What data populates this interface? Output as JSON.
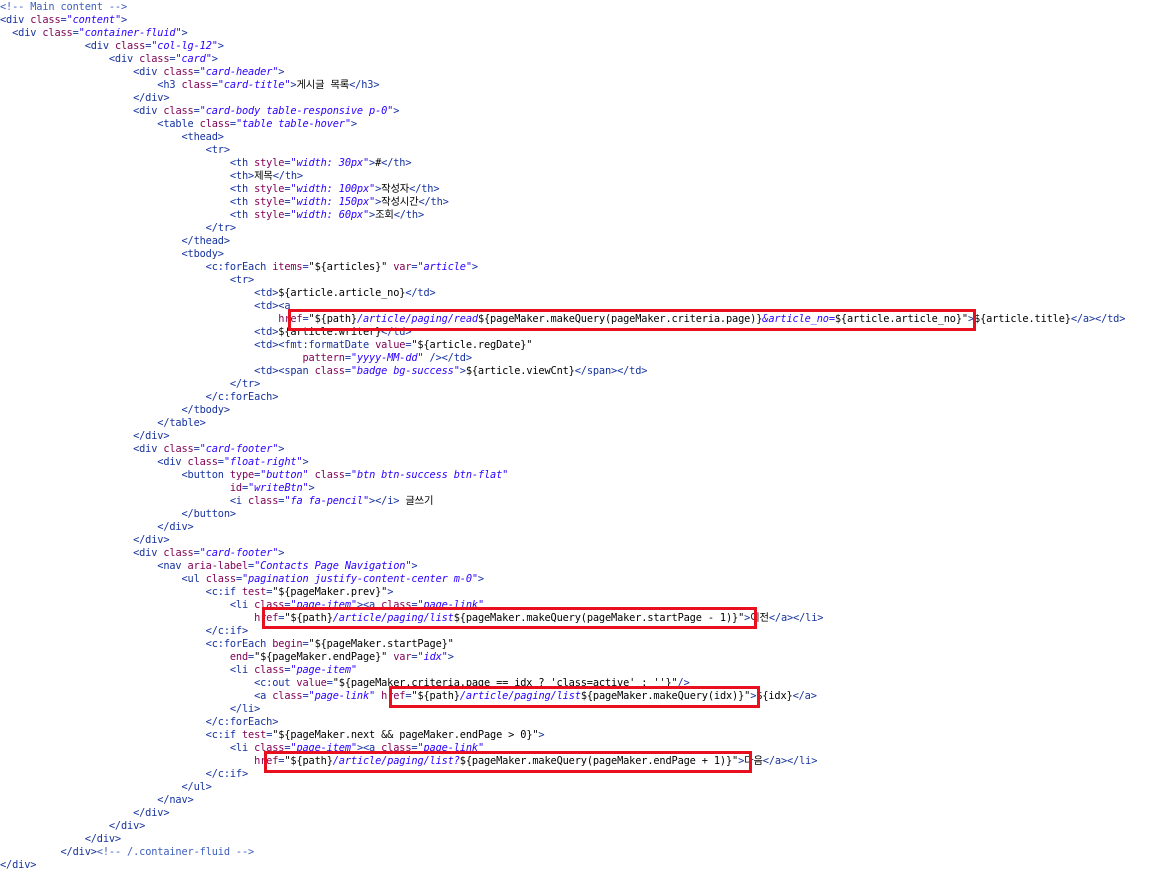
{
  "code_lines": [
    [
      [
        "c",
        "<!-- Main content -->"
      ]
    ],
    [
      [
        "t",
        "<div "
      ],
      [
        "a",
        "class"
      ],
      [
        "t",
        "="
      ],
      [
        "v",
        "\"content\""
      ],
      [
        "t",
        ">"
      ]
    ],
    [
      [
        "t",
        "  <div "
      ],
      [
        "a",
        "class"
      ],
      [
        "t",
        "="
      ],
      [
        "v",
        "\"container-fluid\""
      ],
      [
        "t",
        ">"
      ]
    ],
    [
      [
        "t",
        "              <div "
      ],
      [
        "a",
        "class"
      ],
      [
        "t",
        "="
      ],
      [
        "v",
        "\"col-lg-12\""
      ],
      [
        "t",
        ">"
      ]
    ],
    [
      [
        "t",
        "                  <div "
      ],
      [
        "a",
        "class"
      ],
      [
        "t",
        "="
      ],
      [
        "v",
        "\"card\""
      ],
      [
        "t",
        ">"
      ]
    ],
    [
      [
        "t",
        "                      <div "
      ],
      [
        "a",
        "class"
      ],
      [
        "t",
        "="
      ],
      [
        "v",
        "\"card-header\""
      ],
      [
        "t",
        ">"
      ]
    ],
    [
      [
        "t",
        "                          <h3 "
      ],
      [
        "a",
        "class"
      ],
      [
        "t",
        "="
      ],
      [
        "v",
        "\"card-title\""
      ],
      [
        "t",
        ">"
      ],
      [
        "x",
        "게시글 목록"
      ],
      [
        "t",
        "</h3>"
      ]
    ],
    [
      [
        "t",
        "                      </div>"
      ]
    ],
    [
      [
        "t",
        "                      <div "
      ],
      [
        "a",
        "class"
      ],
      [
        "t",
        "="
      ],
      [
        "v",
        "\"card-body table-responsive p-0\""
      ],
      [
        "t",
        ">"
      ]
    ],
    [
      [
        "t",
        "                          <table "
      ],
      [
        "a",
        "class"
      ],
      [
        "t",
        "="
      ],
      [
        "v",
        "\"table table-hover\""
      ],
      [
        "t",
        ">"
      ]
    ],
    [
      [
        "t",
        "                              <thead>"
      ]
    ],
    [
      [
        "t",
        "                                  <tr>"
      ]
    ],
    [
      [
        "t",
        "                                      <th "
      ],
      [
        "a",
        "style"
      ],
      [
        "t",
        "="
      ],
      [
        "v",
        "\"width: 30px\""
      ],
      [
        "t",
        ">"
      ],
      [
        "x",
        "#"
      ],
      [
        "t",
        "</th>"
      ]
    ],
    [
      [
        "t",
        "                                      <th>"
      ],
      [
        "x",
        "제목"
      ],
      [
        "t",
        "</th>"
      ]
    ],
    [
      [
        "t",
        "                                      <th "
      ],
      [
        "a",
        "style"
      ],
      [
        "t",
        "="
      ],
      [
        "v",
        "\"width: 100px\""
      ],
      [
        "t",
        ">"
      ],
      [
        "x",
        "작성자"
      ],
      [
        "t",
        "</th>"
      ]
    ],
    [
      [
        "t",
        "                                      <th "
      ],
      [
        "a",
        "style"
      ],
      [
        "t",
        "="
      ],
      [
        "v",
        "\"width: 150px\""
      ],
      [
        "t",
        ">"
      ],
      [
        "x",
        "작성시간"
      ],
      [
        "t",
        "</th>"
      ]
    ],
    [
      [
        "t",
        "                                      <th "
      ],
      [
        "a",
        "style"
      ],
      [
        "t",
        "="
      ],
      [
        "v",
        "\"width: 60px\""
      ],
      [
        "t",
        ">"
      ],
      [
        "x",
        "조회"
      ],
      [
        "t",
        "</th>"
      ]
    ],
    [
      [
        "t",
        "                                  </tr>"
      ]
    ],
    [
      [
        "t",
        "                              </thead>"
      ]
    ],
    [
      [
        "t",
        "                              <tbody>"
      ]
    ],
    [
      [
        "t",
        "                                  <c:forEach "
      ],
      [
        "a",
        "items"
      ],
      [
        "t",
        "="
      ],
      [
        "x",
        "\"${articles}\""
      ],
      [
        "t",
        " "
      ],
      [
        "a",
        "var"
      ],
      [
        "t",
        "="
      ],
      [
        "v",
        "\"article\""
      ],
      [
        "t",
        ">"
      ]
    ],
    [
      [
        "t",
        "                                      <tr>"
      ]
    ],
    [
      [
        "t",
        "                                          <td>"
      ],
      [
        "x",
        "${article.article_no}"
      ],
      [
        "t",
        "</td>"
      ]
    ],
    [
      [
        "t",
        "                                          <td><a"
      ]
    ],
    [
      [
        "t",
        "                                              "
      ],
      [
        "a",
        "href"
      ],
      [
        "t",
        "="
      ],
      [
        "x",
        "\"${path}"
      ],
      [
        "v",
        "/article/paging/read"
      ],
      [
        "x",
        "${pageMaker.makeQuery(pageMaker.criteria.page)}"
      ],
      [
        "v",
        "&article_no="
      ],
      [
        "x",
        "${article.article_no}\""
      ],
      [
        "t",
        ">"
      ],
      [
        "x",
        "${article.title}"
      ],
      [
        "t",
        "</a></td>"
      ]
    ],
    [
      [
        "t",
        "                                          <td>"
      ],
      [
        "x",
        "${article.writer}"
      ],
      [
        "t",
        "</td>"
      ]
    ],
    [
      [
        "t",
        "                                          <td><fmt:formatDate "
      ],
      [
        "a",
        "value"
      ],
      [
        "t",
        "="
      ],
      [
        "x",
        "\"${article.regDate}\""
      ]
    ],
    [
      [
        "t",
        "                                                  "
      ],
      [
        "a",
        "pattern"
      ],
      [
        "t",
        "="
      ],
      [
        "v",
        "\"yyyy-MM-dd\""
      ],
      [
        "t",
        " /></td>"
      ]
    ],
    [
      [
        "t",
        "                                          <td><span "
      ],
      [
        "a",
        "class"
      ],
      [
        "t",
        "="
      ],
      [
        "v",
        "\"badge bg-success\""
      ],
      [
        "t",
        ">"
      ],
      [
        "x",
        "${article.viewCnt}"
      ],
      [
        "t",
        "</span></td>"
      ]
    ],
    [
      [
        "t",
        "                                      </tr>"
      ]
    ],
    [
      [
        "t",
        "                                  </c:forEach>"
      ]
    ],
    [
      [
        "t",
        "                              </tbody>"
      ]
    ],
    [
      [
        "t",
        "                          </table>"
      ]
    ],
    [
      [
        "t",
        "                      </div>"
      ]
    ],
    [
      [
        "t",
        "                      <div "
      ],
      [
        "a",
        "class"
      ],
      [
        "t",
        "="
      ],
      [
        "v",
        "\"card-footer\""
      ],
      [
        "t",
        ">"
      ]
    ],
    [
      [
        "t",
        "                          <div "
      ],
      [
        "a",
        "class"
      ],
      [
        "t",
        "="
      ],
      [
        "v",
        "\"float-right\""
      ],
      [
        "t",
        ">"
      ]
    ],
    [
      [
        "t",
        "                              <button "
      ],
      [
        "a",
        "type"
      ],
      [
        "t",
        "="
      ],
      [
        "v",
        "\"button\""
      ],
      [
        "t",
        " "
      ],
      [
        "a",
        "class"
      ],
      [
        "t",
        "="
      ],
      [
        "v",
        "\"btn btn-success btn-flat\""
      ]
    ],
    [
      [
        "t",
        "                                      "
      ],
      [
        "a",
        "id"
      ],
      [
        "t",
        "="
      ],
      [
        "v",
        "\"writeBtn\""
      ],
      [
        "t",
        ">"
      ]
    ],
    [
      [
        "t",
        "                                      <i "
      ],
      [
        "a",
        "class"
      ],
      [
        "t",
        "="
      ],
      [
        "v",
        "\"fa fa-pencil\""
      ],
      [
        "t",
        "></i>"
      ],
      [
        "x",
        " 글쓰기"
      ]
    ],
    [
      [
        "t",
        "                              </button>"
      ]
    ],
    [
      [
        "t",
        "                          </div>"
      ]
    ],
    [
      [
        "t",
        "                      </div>"
      ]
    ],
    [
      [
        "t",
        "                      <div "
      ],
      [
        "a",
        "class"
      ],
      [
        "t",
        "="
      ],
      [
        "v",
        "\"card-footer\""
      ],
      [
        "t",
        ">"
      ]
    ],
    [
      [
        "t",
        "                          <nav "
      ],
      [
        "a",
        "aria-label"
      ],
      [
        "t",
        "="
      ],
      [
        "v",
        "\"Contacts Page Navigation\""
      ],
      [
        "t",
        ">"
      ]
    ],
    [
      [
        "t",
        "                              <ul "
      ],
      [
        "a",
        "class"
      ],
      [
        "t",
        "="
      ],
      [
        "v",
        "\"pagination justify-content-center m-0\""
      ],
      [
        "t",
        ">"
      ]
    ],
    [
      [
        "t",
        "                                  <c:if "
      ],
      [
        "a",
        "test"
      ],
      [
        "t",
        "="
      ],
      [
        "x",
        "\"${pageMaker.prev}\""
      ],
      [
        "t",
        ">"
      ]
    ],
    [
      [
        "t",
        "                                      <li "
      ],
      [
        "a",
        "class"
      ],
      [
        "t",
        "="
      ],
      [
        "v",
        "\"page-item\""
      ],
      [
        "t",
        "><a "
      ],
      [
        "a",
        "class"
      ],
      [
        "t",
        "="
      ],
      [
        "v",
        "\"page-link\""
      ]
    ],
    [
      [
        "t",
        "                                          "
      ],
      [
        "a",
        "href"
      ],
      [
        "t",
        "="
      ],
      [
        "x",
        "\"${path}"
      ],
      [
        "v",
        "/article/paging/list"
      ],
      [
        "x",
        "${pageMaker.makeQuery(pageMaker.startPage - 1)}\""
      ],
      [
        "t",
        ">"
      ],
      [
        "x",
        "이전"
      ],
      [
        "t",
        "</a></li>"
      ]
    ],
    [
      [
        "t",
        "                                  </c:if>"
      ]
    ],
    [
      [
        "t",
        "                                  <c:forEach "
      ],
      [
        "a",
        "begin"
      ],
      [
        "t",
        "="
      ],
      [
        "x",
        "\"${pageMaker.startPage}\""
      ]
    ],
    [
      [
        "t",
        "                                      "
      ],
      [
        "a",
        "end"
      ],
      [
        "t",
        "="
      ],
      [
        "x",
        "\"${pageMaker.endPage}\""
      ],
      [
        "t",
        " "
      ],
      [
        "a",
        "var"
      ],
      [
        "t",
        "="
      ],
      [
        "v",
        "\"idx\""
      ],
      [
        "t",
        ">"
      ]
    ],
    [
      [
        "t",
        "                                      <li "
      ],
      [
        "a",
        "class"
      ],
      [
        "t",
        "="
      ],
      [
        "v",
        "\"page-item\""
      ]
    ],
    [
      [
        "t",
        "                                          <c:out "
      ],
      [
        "a",
        "value"
      ],
      [
        "t",
        "="
      ],
      [
        "x",
        "\"${pageMaker.criteria.page == idx ? 'class=active' : ''}\""
      ],
      [
        "t",
        "/>"
      ]
    ],
    [
      [
        "t",
        "                                          <a "
      ],
      [
        "a",
        "class"
      ],
      [
        "t",
        "="
      ],
      [
        "v",
        "\"page-link\""
      ],
      [
        "t",
        " "
      ],
      [
        "a",
        "href"
      ],
      [
        "t",
        "="
      ],
      [
        "x",
        "\"${path}"
      ],
      [
        "v",
        "/article/paging/list"
      ],
      [
        "x",
        "${pageMaker.makeQuery(idx)}\""
      ],
      [
        "t",
        ">"
      ],
      [
        "x",
        "${idx}"
      ],
      [
        "t",
        "</a>"
      ]
    ],
    [
      [
        "t",
        "                                      </li>"
      ]
    ],
    [
      [
        "t",
        "                                  </c:forEach>"
      ]
    ],
    [
      [
        "t",
        "                                  <c:if "
      ],
      [
        "a",
        "test"
      ],
      [
        "t",
        "="
      ],
      [
        "x",
        "\"${pageMaker.next && pageMaker.endPage > 0}\""
      ],
      [
        "t",
        ">"
      ]
    ],
    [
      [
        "t",
        "                                      <li "
      ],
      [
        "a",
        "class"
      ],
      [
        "t",
        "="
      ],
      [
        "v",
        "\"page-item\""
      ],
      [
        "t",
        "><a "
      ],
      [
        "a",
        "class"
      ],
      [
        "t",
        "="
      ],
      [
        "v",
        "\"page-link\""
      ]
    ],
    [
      [
        "t",
        "                                          "
      ],
      [
        "a",
        "href"
      ],
      [
        "t",
        "="
      ],
      [
        "x",
        "\"${path}"
      ],
      [
        "v",
        "/article/paging/list?"
      ],
      [
        "x",
        "${pageMaker.makeQuery(pageMaker.endPage + 1)}\""
      ],
      [
        "t",
        ">"
      ],
      [
        "x",
        "다음"
      ],
      [
        "t",
        "</a></li>"
      ]
    ],
    [
      [
        "t",
        "                                  </c:if>"
      ]
    ],
    [
      [
        "t",
        "                              </ul>"
      ]
    ],
    [
      [
        "t",
        "                          </nav>"
      ]
    ],
    [
      [
        "t",
        "                      </div>"
      ]
    ],
    [
      [
        "t",
        "                  </div>"
      ]
    ],
    [
      [
        "t",
        "              </div>"
      ]
    ],
    [
      [
        "t",
        "          </div>"
      ],
      [
        "c",
        "<!-- /.container-fluid -->"
      ]
    ],
    [
      [
        "t",
        "</div>"
      ]
    ]
  ],
  "highlight_count": 4
}
